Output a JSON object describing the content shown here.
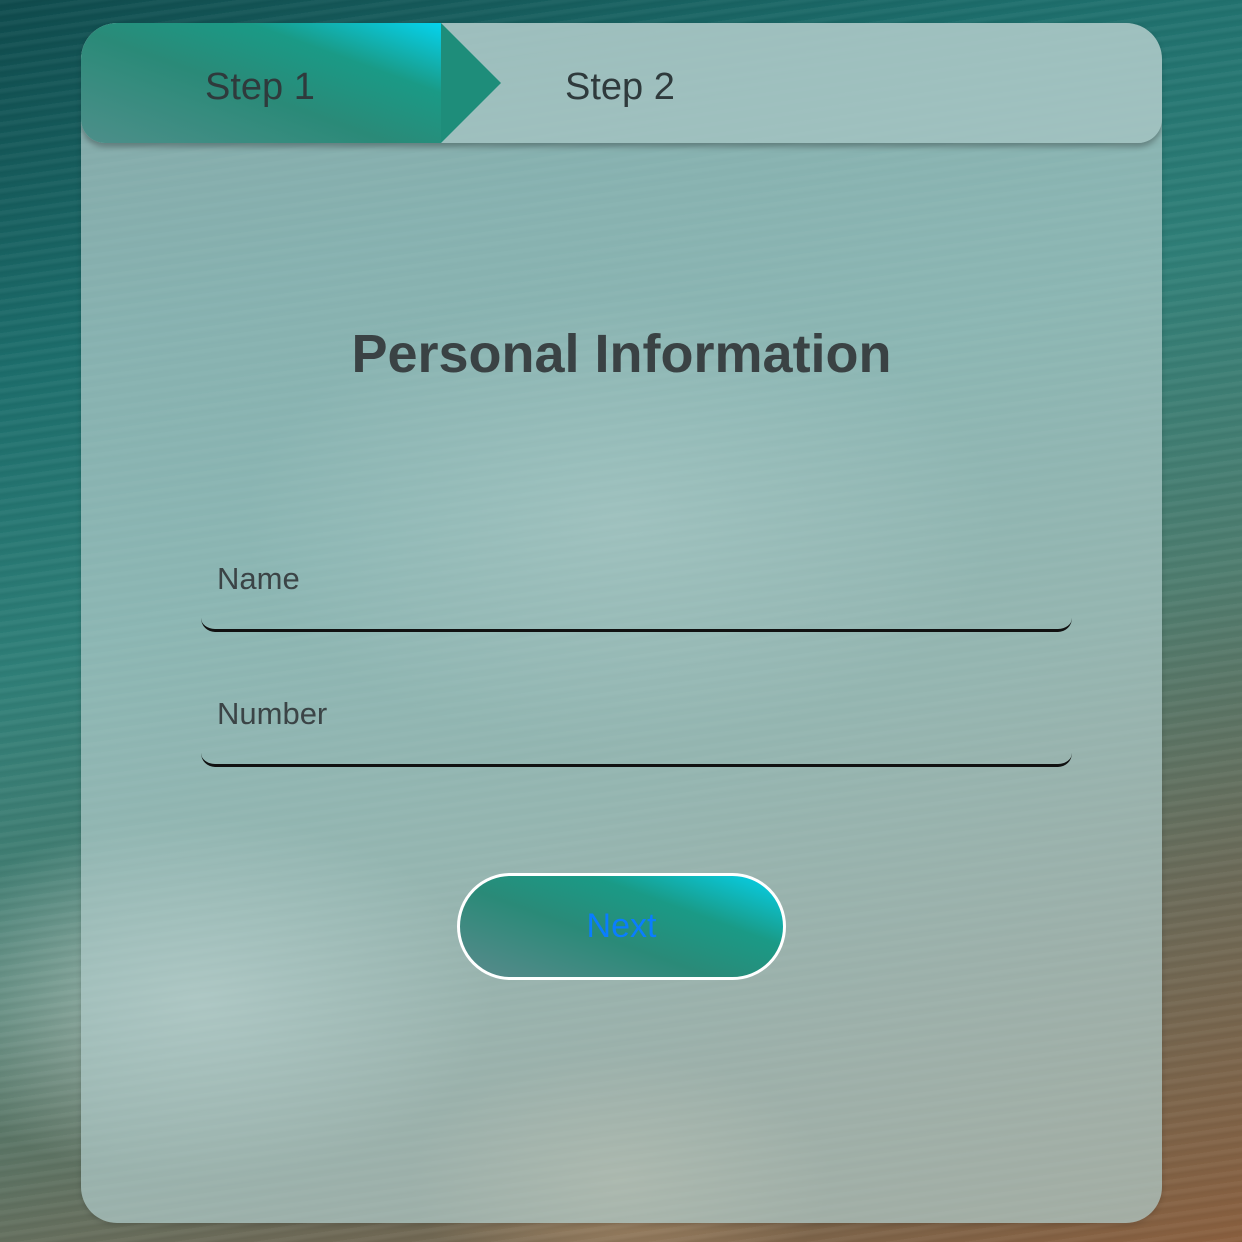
{
  "steps": [
    {
      "label": "Step 1",
      "active": true
    },
    {
      "label": "Step 2",
      "active": false
    }
  ],
  "form": {
    "title": "Personal Information",
    "fields": {
      "name": {
        "placeholder": "Name",
        "value": ""
      },
      "number": {
        "placeholder": "Number",
        "value": ""
      }
    },
    "next_label": "Next"
  },
  "colors": {
    "accent_start": "#05d3ee",
    "accent_end": "#2a8a78",
    "button_text": "#0a7dff",
    "title_text": "#3a4244"
  }
}
